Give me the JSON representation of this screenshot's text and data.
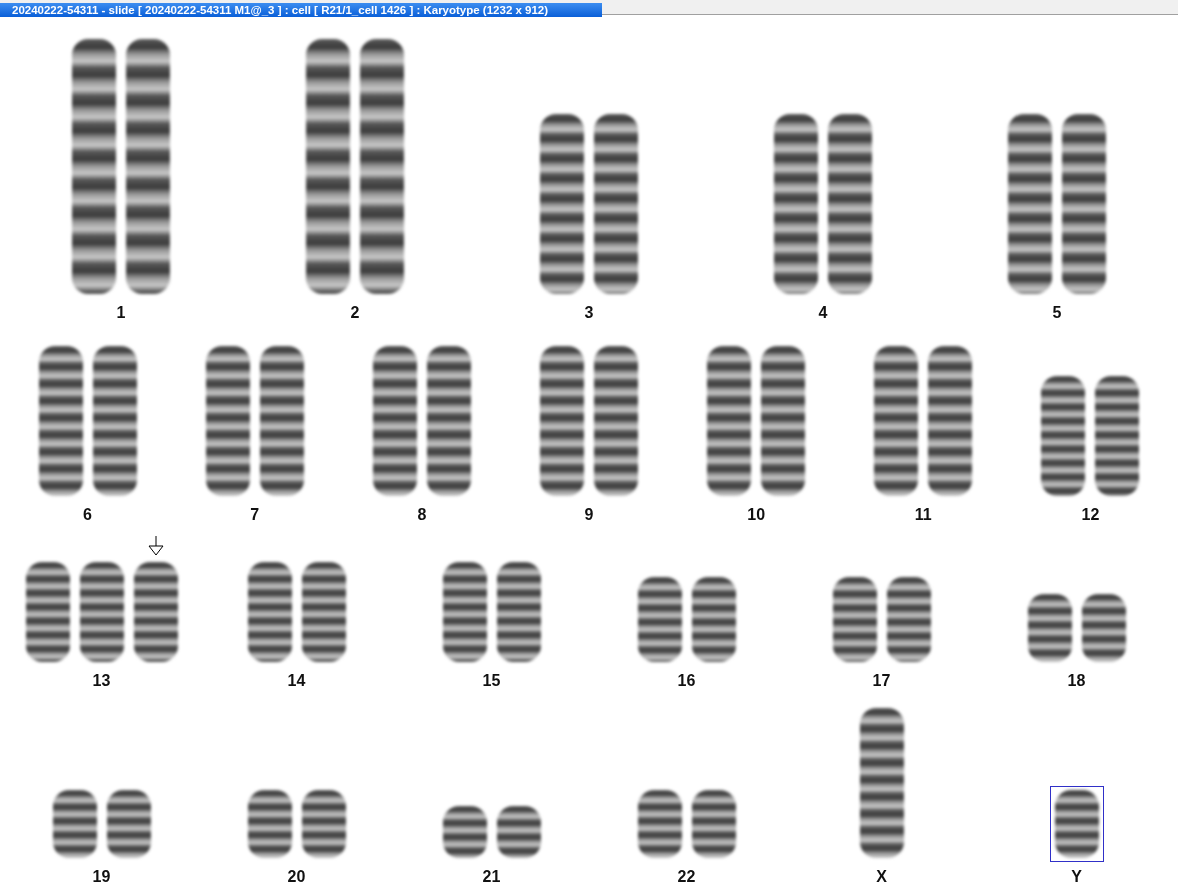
{
  "window": {
    "title": "20240222-54311 - slide [ 20240222-54311 M1@_3 ] : cell [ R21/1_cell 1426 ] : Karyotype  (1232 x 912)"
  },
  "rows": [
    {
      "groups": [
        {
          "label": "1",
          "kind": "xl",
          "selected": false,
          "chromosomes": [
            {
              "kind": "normal"
            },
            {
              "kind": "normal"
            }
          ]
        },
        {
          "label": "2",
          "kind": "xl",
          "selected": false,
          "chromosomes": [
            {
              "kind": "normal"
            },
            {
              "kind": "normal"
            }
          ]
        },
        {
          "label": "3",
          "kind": "l",
          "selected": false,
          "chromosomes": [
            {
              "kind": "normal"
            },
            {
              "kind": "normal"
            }
          ]
        },
        {
          "label": "4",
          "kind": "l",
          "selected": false,
          "chromosomes": [
            {
              "kind": "normal"
            },
            {
              "kind": "normal"
            }
          ]
        },
        {
          "label": "5",
          "kind": "l",
          "selected": false,
          "chromosomes": [
            {
              "kind": "normal"
            },
            {
              "kind": "normal"
            }
          ]
        }
      ]
    },
    {
      "groups": [
        {
          "label": "6",
          "kind": "m",
          "selected": false,
          "chromosomes": [
            {
              "kind": "normal"
            },
            {
              "kind": "normal"
            }
          ]
        },
        {
          "label": "7",
          "kind": "m",
          "selected": false,
          "chromosomes": [
            {
              "kind": "normal"
            },
            {
              "kind": "normal"
            }
          ]
        },
        {
          "label": "8",
          "kind": "m",
          "selected": false,
          "chromosomes": [
            {
              "kind": "normal"
            },
            {
              "kind": "normal"
            }
          ]
        },
        {
          "label": "9",
          "kind": "m",
          "selected": false,
          "chromosomes": [
            {
              "kind": "normal"
            },
            {
              "kind": "normal"
            }
          ]
        },
        {
          "label": "10",
          "kind": "m",
          "selected": false,
          "chromosomes": [
            {
              "kind": "normal"
            },
            {
              "kind": "normal"
            }
          ]
        },
        {
          "label": "11",
          "kind": "m",
          "selected": false,
          "chromosomes": [
            {
              "kind": "normal"
            },
            {
              "kind": "normal"
            }
          ]
        },
        {
          "label": "12",
          "kind": "ms",
          "selected": false,
          "chromosomes": [
            {
              "kind": "normal"
            },
            {
              "kind": "normal"
            }
          ]
        }
      ]
    },
    {
      "groups": [
        {
          "label": "13",
          "kind": "s",
          "selected": false,
          "chromosomes": [
            {
              "kind": "normal"
            },
            {
              "kind": "normal"
            },
            {
              "kind": "marked"
            }
          ]
        },
        {
          "label": "14",
          "kind": "s",
          "selected": false,
          "chromosomes": [
            {
              "kind": "normal"
            },
            {
              "kind": "normal"
            }
          ]
        },
        {
          "label": "15",
          "kind": "s",
          "selected": false,
          "chromosomes": [
            {
              "kind": "normal"
            },
            {
              "kind": "normal"
            }
          ]
        },
        {
          "label": "16",
          "kind": "ss",
          "selected": false,
          "chromosomes": [
            {
              "kind": "normal"
            },
            {
              "kind": "normal"
            }
          ]
        },
        {
          "label": "17",
          "kind": "ss",
          "selected": false,
          "chromosomes": [
            {
              "kind": "normal"
            },
            {
              "kind": "normal"
            }
          ]
        },
        {
          "label": "18",
          "kind": "xs",
          "selected": false,
          "chromosomes": [
            {
              "kind": "normal"
            },
            {
              "kind": "normal"
            }
          ]
        }
      ]
    },
    {
      "groups": [
        {
          "label": "19",
          "kind": "xs",
          "selected": false,
          "chromosomes": [
            {
              "kind": "normal"
            },
            {
              "kind": "normal"
            }
          ]
        },
        {
          "label": "20",
          "kind": "xs",
          "selected": false,
          "chromosomes": [
            {
              "kind": "normal"
            },
            {
              "kind": "normal"
            }
          ]
        },
        {
          "label": "21",
          "kind": "xxs",
          "selected": false,
          "chromosomes": [
            {
              "kind": "normal"
            },
            {
              "kind": "normal"
            }
          ]
        },
        {
          "label": "22",
          "kind": "xs",
          "selected": false,
          "chromosomes": [
            {
              "kind": "normal"
            },
            {
              "kind": "normal"
            }
          ]
        },
        {
          "label": "X",
          "kind": "m",
          "selected": false,
          "chromosomes": [
            {
              "kind": "normal"
            }
          ]
        },
        {
          "label": "Y",
          "kind": "xs",
          "selected": true,
          "chromosomes": [
            {
              "kind": "normal"
            }
          ]
        }
      ]
    }
  ]
}
